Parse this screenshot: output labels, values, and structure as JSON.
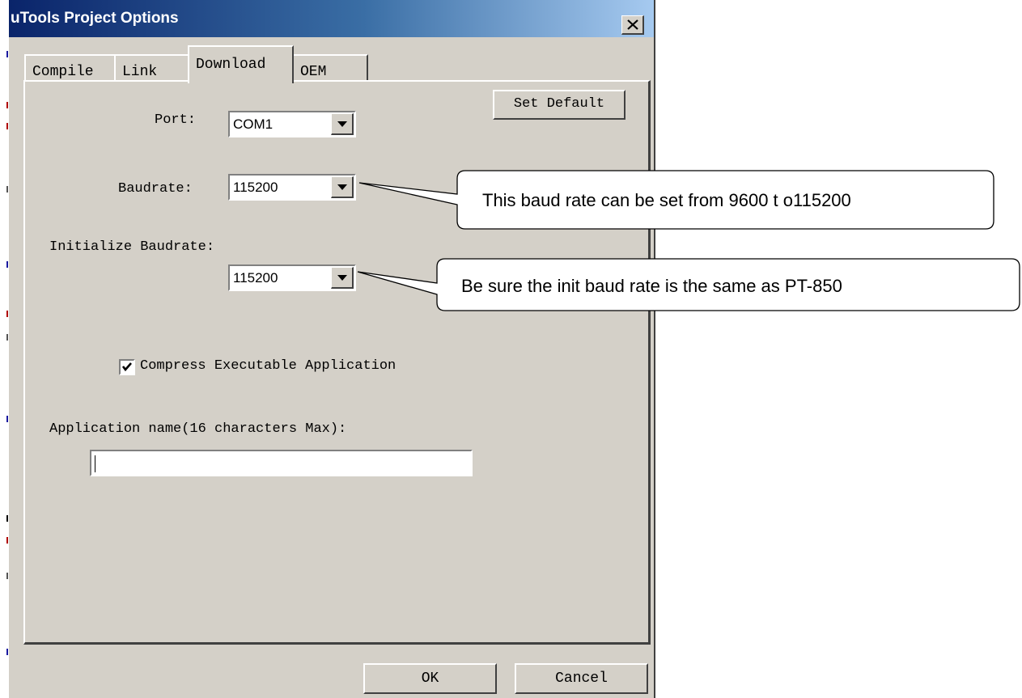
{
  "window": {
    "title": "uTools Project Options"
  },
  "tabs": [
    {
      "label": "Compile"
    },
    {
      "label": "Link"
    },
    {
      "label": "Download",
      "active": true
    },
    {
      "label": "OEM"
    }
  ],
  "download": {
    "set_default_label": "Set Default",
    "port_label": "Port:",
    "port_value": "COM1",
    "baudrate_label": "Baudrate:",
    "baudrate_value": "115200",
    "init_baudrate_label": "Initialize Baudrate:",
    "init_baudrate_value": "115200",
    "compress_label": "Compress Executable Application",
    "compress_checked": true,
    "app_name_label": "Application name(16 characters Max):",
    "app_name_value": ""
  },
  "footer": {
    "ok_label": "OK",
    "cancel_label": "Cancel"
  },
  "callouts": [
    {
      "text": "This baud rate can be set from 9600 t o115200"
    },
    {
      "text": "Be sure the init baud rate is the same as PT-850"
    }
  ]
}
